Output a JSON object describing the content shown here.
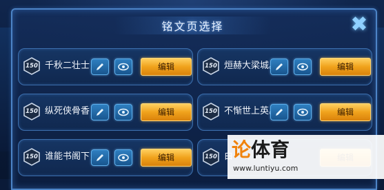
{
  "dialog": {
    "title": "铭文页选择",
    "close_icon": "close-x-icon"
  },
  "pages": [
    {
      "level": "150",
      "name": "千秋二壮士，",
      "edit_label": "编辑"
    },
    {
      "level": "150",
      "name": "烜赫大梁城。",
      "edit_label": "编辑"
    },
    {
      "level": "150",
      "name": "纵死侠骨香，",
      "edit_label": "编辑"
    },
    {
      "level": "150",
      "name": "不惭世上英。",
      "edit_label": "编辑"
    },
    {
      "level": "150",
      "name": "谁能书阁下，",
      "edit_label": "编辑"
    },
    {
      "level": "150",
      "name": "白",
      "edit_label": "编辑"
    }
  ],
  "watermark": {
    "brand_1": "论",
    "brand_2": "体育",
    "url": "www.luntiyu.com"
  },
  "colors": {
    "accent_blue": "#4d84c7",
    "edit_button_orange": "#f0a21c"
  }
}
